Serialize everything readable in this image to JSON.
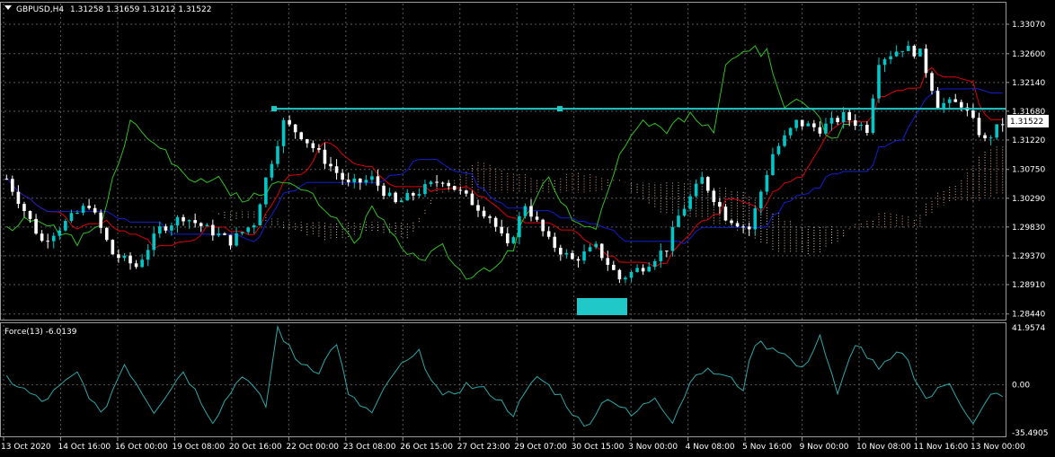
{
  "header": {
    "symbol": "GBPUSD,H4",
    "ohlc": "1.31258 1.31659 1.31212 1.31522",
    "indicator": "Force(13) -6.0139"
  },
  "colors": {
    "background": "#000000",
    "grid": "#5a5a5a",
    "bull": "#00c8c8",
    "bear": "#ffffff",
    "tenkan": "#e00000",
    "kijun": "#1020d0",
    "chikou": "#30c020",
    "cloud_a": "#e0a080",
    "cloud_b": "#d0c0b0",
    "hline": "#20c8c8",
    "force": "#2aa7a7"
  },
  "chart_data": [
    {
      "type": "candlestick",
      "title": "GBPUSD,H4",
      "y_ticks": [
        "1.33070",
        "1.32600",
        "1.32140",
        "1.31680",
        "1.31220",
        "1.30750",
        "1.30290",
        "1.29830",
        "1.29370",
        "1.28910",
        "1.28440"
      ],
      "ylim": [
        1.2835,
        1.334
      ],
      "current_price": "1.31522",
      "horizontal_line": 1.3172,
      "x_ticks": [
        "13 Oct 2020",
        "14 Oct 16:00",
        "16 Oct 00:00",
        "19 Oct 08:00",
        "20 Oct 16:00",
        "22 Oct 00:00",
        "23 Oct 08:00",
        "26 Oct 15:00",
        "27 Oct 23:00",
        "29 Oct 07:00",
        "30 Oct 15:00",
        "3 Nov 00:00",
        "4 Nov 08:00",
        "5 Nov 16:00",
        "9 Nov 00:00",
        "10 Nov 08:00",
        "11 Nov 16:00",
        "13 Nov 00:00"
      ],
      "anchors": [
        [
          0,
          1.306
        ],
        [
          6,
          1.296
        ],
        [
          10,
          1.299
        ],
        [
          14,
          1.302
        ],
        [
          18,
          1.294
        ],
        [
          22,
          1.292
        ],
        [
          26,
          1.298
        ],
        [
          30,
          1.3
        ],
        [
          34,
          1.298
        ],
        [
          38,
          1.296
        ],
        [
          42,
          1.299
        ],
        [
          44,
          1.306
        ],
        [
          47,
          1.315
        ],
        [
          50,
          1.313
        ],
        [
          54,
          1.309
        ],
        [
          58,
          1.305
        ],
        [
          62,
          1.306
        ],
        [
          66,
          1.302
        ],
        [
          70,
          1.304
        ],
        [
          74,
          1.306
        ],
        [
          78,
          1.303
        ],
        [
          82,
          1.3
        ],
        [
          85,
          1.295
        ],
        [
          88,
          1.302
        ],
        [
          92,
          1.296
        ],
        [
          96,
          1.293
        ],
        [
          100,
          1.295
        ],
        [
          104,
          1.29
        ],
        [
          108,
          1.292
        ],
        [
          112,
          1.295
        ],
        [
          114,
          1.3
        ],
        [
          118,
          1.306
        ],
        [
          122,
          1.3
        ],
        [
          126,
          1.298
        ],
        [
          130,
          1.31
        ],
        [
          134,
          1.315
        ],
        [
          138,
          1.314
        ],
        [
          142,
          1.316
        ],
        [
          146,
          1.314
        ],
        [
          148,
          1.325
        ],
        [
          152,
          1.327
        ],
        [
          155,
          1.326
        ],
        [
          158,
          1.318
        ],
        [
          162,
          1.318
        ],
        [
          166,
          1.312
        ],
        [
          169,
          1.315
        ]
      ],
      "series": [
        {
          "name": "Force(13)",
          "type": "line",
          "ylim": [
            -35.4905,
            41.9574
          ],
          "y_ticks": [
            "41.9574",
            "0.00",
            "-35.4905"
          ],
          "anchors": [
            [
              0,
              5
            ],
            [
              6,
              -12
            ],
            [
              12,
              8
            ],
            [
              16,
              -22
            ],
            [
              20,
              15
            ],
            [
              25,
              -18
            ],
            [
              30,
              10
            ],
            [
              35,
              -25
            ],
            [
              40,
              8
            ],
            [
              44,
              -15
            ],
            [
              46,
              40
            ],
            [
              49,
              18
            ],
            [
              53,
              10
            ],
            [
              56,
              30
            ],
            [
              58,
              -8
            ],
            [
              62,
              -20
            ],
            [
              66,
              10
            ],
            [
              70,
              22
            ],
            [
              74,
              -10
            ],
            [
              78,
              0
            ],
            [
              82,
              -5
            ],
            [
              86,
              -20
            ],
            [
              90,
              6
            ],
            [
              94,
              -8
            ],
            [
              98,
              -30
            ],
            [
              102,
              -8
            ],
            [
              106,
              -22
            ],
            [
              110,
              -8
            ],
            [
              113,
              -25
            ],
            [
              117,
              10
            ],
            [
              121,
              8
            ],
            [
              125,
              -2
            ],
            [
              127,
              30
            ],
            [
              131,
              25
            ],
            [
              135,
              10
            ],
            [
              138,
              35
            ],
            [
              141,
              -8
            ],
            [
              144,
              30
            ],
            [
              148,
              10
            ],
            [
              152,
              24
            ],
            [
              156,
              -10
            ],
            [
              160,
              2
            ],
            [
              164,
              -28
            ],
            [
              167,
              -8
            ],
            [
              169,
              -6
            ]
          ]
        }
      ]
    }
  ]
}
